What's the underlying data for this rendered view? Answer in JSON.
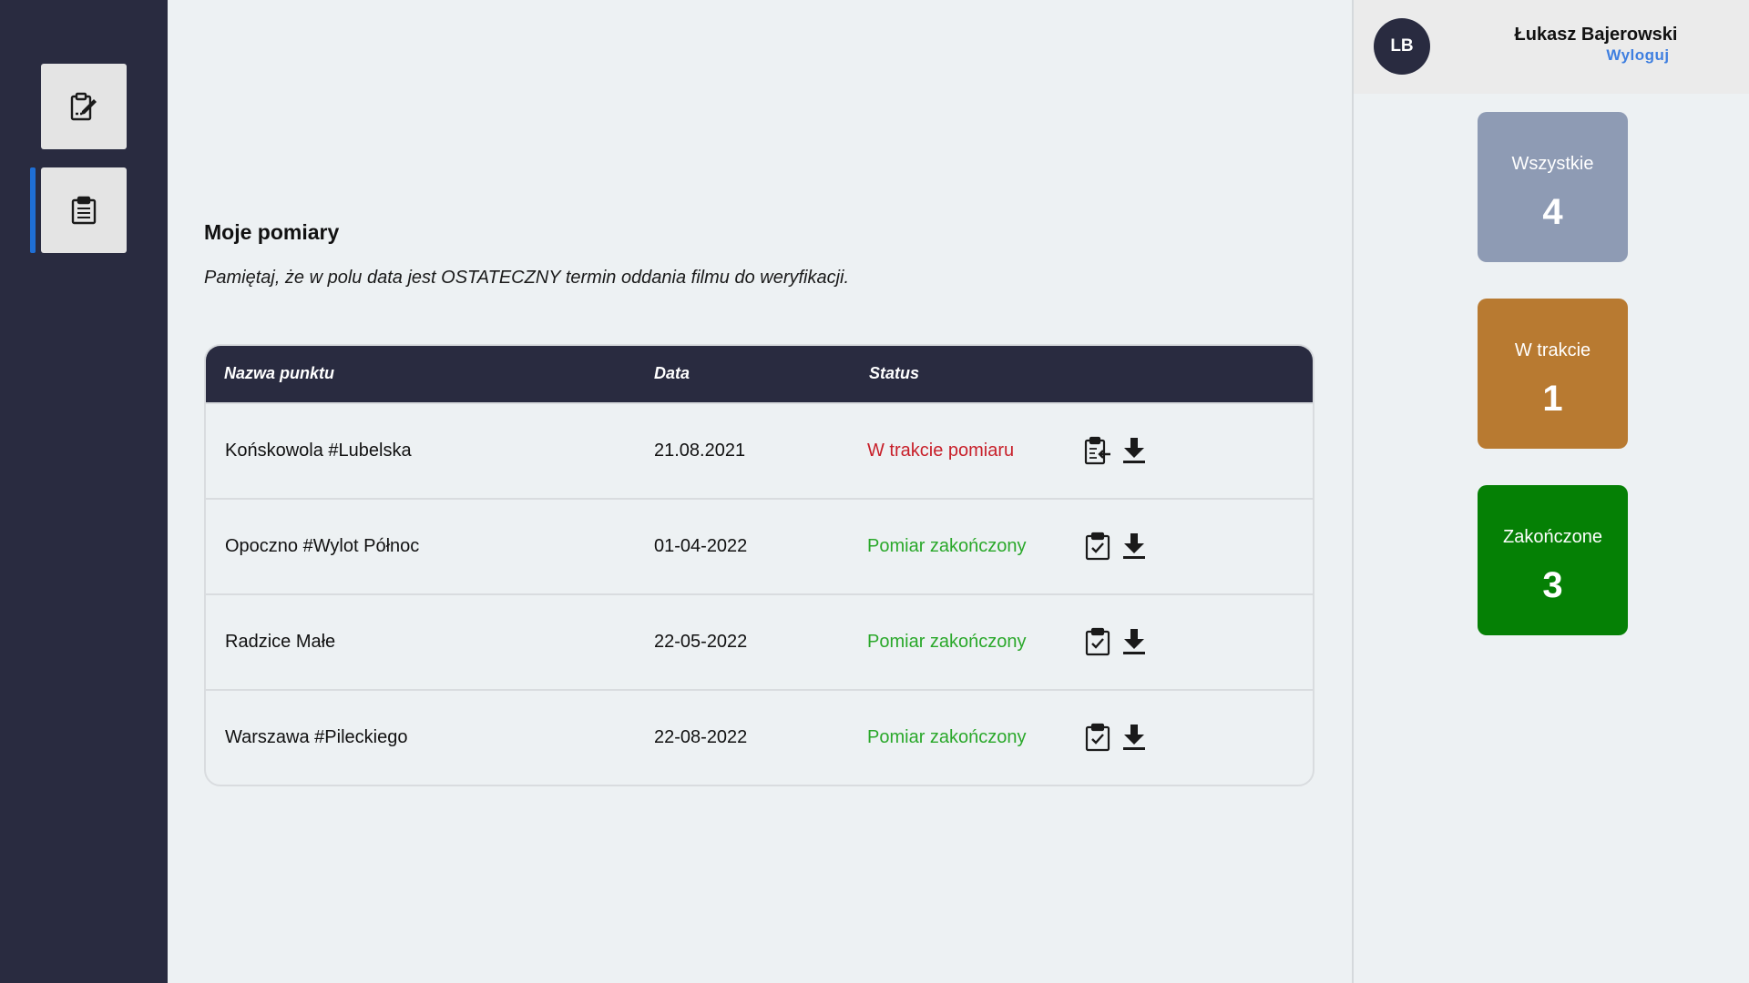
{
  "sidebar": {
    "items": [
      {
        "icon": "clipboard-edit-icon"
      },
      {
        "icon": "clipboard-list-icon",
        "active": true
      }
    ]
  },
  "main": {
    "title": "Moje pomiary",
    "note": "Pamiętaj, że w polu data jest OSTATECZNY termin oddania filmu do weryfikacji.",
    "table": {
      "headers": {
        "name": "Nazwa punktu",
        "date": "Data",
        "status": "Status"
      },
      "rows": [
        {
          "name": "Końskowola #Lubelska",
          "date": "21.08.2021",
          "status": "W trakcie pomiaru",
          "state": "progress"
        },
        {
          "name": "Opoczno #Wylot Północ",
          "date": "01-04-2022",
          "status": "Pomiar zakończony",
          "state": "done"
        },
        {
          "name": "Radzice Małe",
          "date": "22-05-2022",
          "status": "Pomiar zakończony",
          "state": "done"
        },
        {
          "name": "Warszawa #Pileckiego",
          "date": "22-08-2022",
          "status": "Pomiar zakończony",
          "state": "done"
        }
      ]
    }
  },
  "user": {
    "initials": "LB",
    "name": "Łukasz Bajerowski",
    "logout_label": "Wyloguj"
  },
  "stats": {
    "all": {
      "label": "Wszystkie",
      "count": "4",
      "color": "#8e9bb4"
    },
    "in_progress": {
      "label": "W trakcie",
      "count": "1",
      "color": "#b87a31"
    },
    "done": {
      "label": "Zakończone",
      "count": "3",
      "color": "#058005"
    }
  },
  "colors": {
    "sidebar_bg": "#292b40",
    "accent": "#1f6fd6",
    "status_progress": "#c8202a",
    "status_done": "#2aa82a",
    "link": "#3f7fe0"
  }
}
